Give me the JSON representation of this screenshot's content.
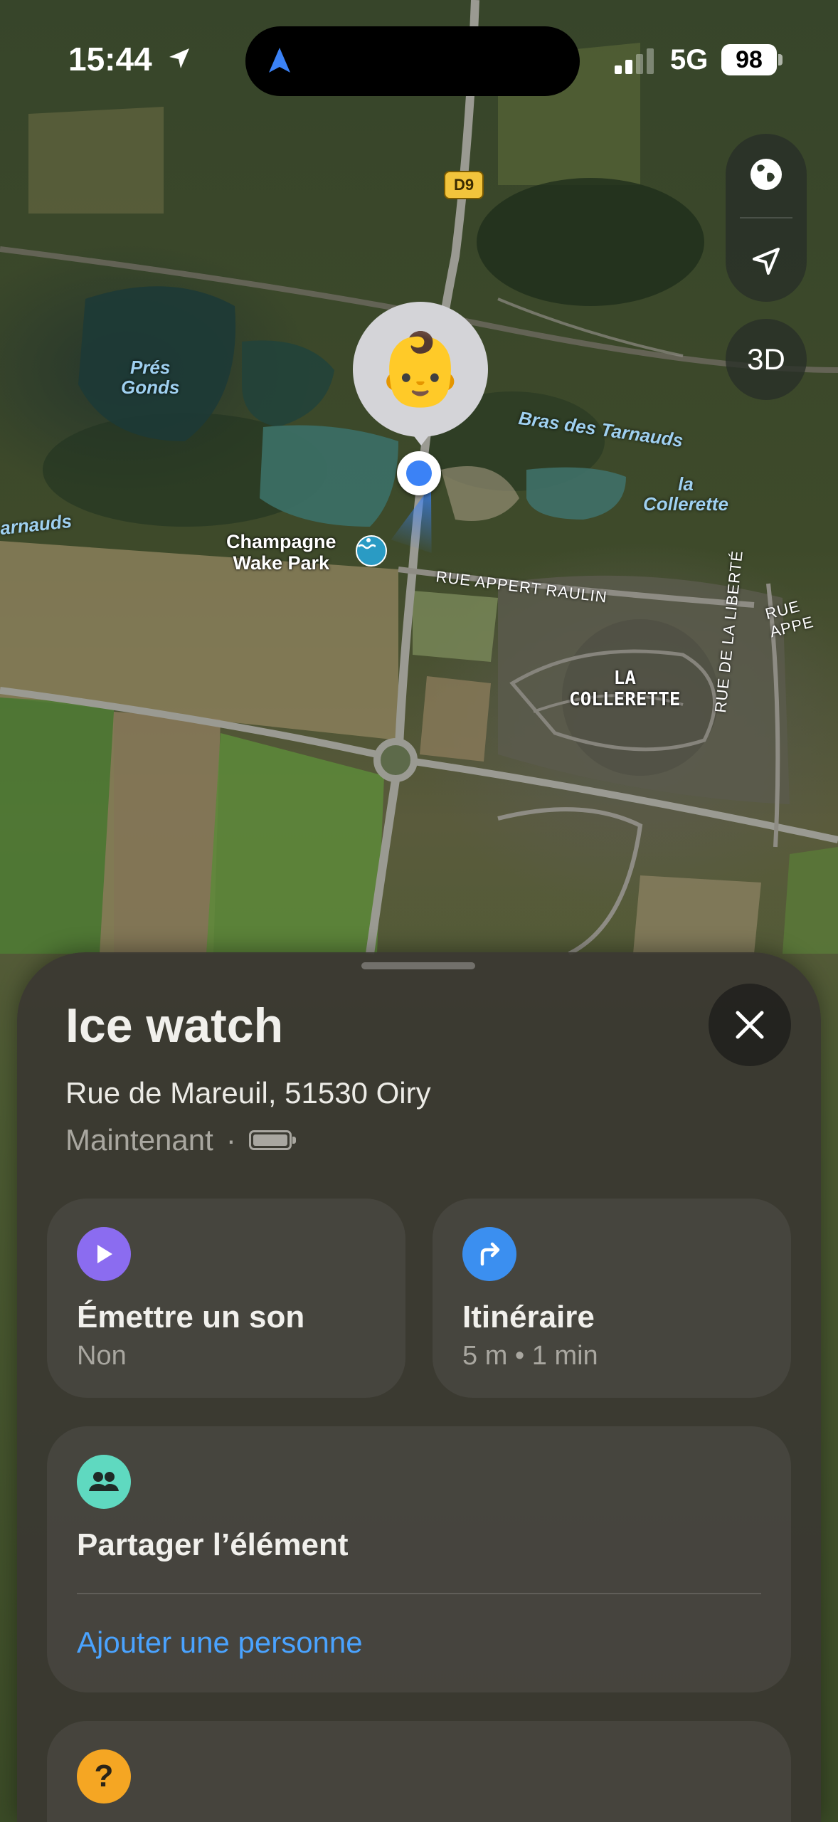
{
  "status_bar": {
    "time": "15:44",
    "network": "5G",
    "battery": "98"
  },
  "map": {
    "controls": {
      "globe_icon": "globe-icon",
      "location_icon": "location-arrow-icon",
      "three_d_label": "3D"
    },
    "road_badge": "D9",
    "labels": {
      "pres_gonds_1": "Prés",
      "pres_gonds_2": "Gonds",
      "bras": "Bras des Tarnauds",
      "collerette_water_1": "la",
      "collerette_water_2": "Collerette",
      "tarnauds_left": "arnauds",
      "wake_park_1": "Champagne",
      "wake_park_2": "Wake Park",
      "rue_appert": "RUE APPERT RAULIN",
      "rue_appe_right": "RUE APPE",
      "la_collerette_1": "LA",
      "la_collerette_2": "COLLERETTE",
      "rue_liberte": "RUE DE LA LIBERTÉ"
    },
    "pin_emoji": "👶"
  },
  "sheet": {
    "title": "Ice watch",
    "address": "Rue de Mareuil, 51530 Oiry",
    "time_label": "Maintenant",
    "separator": "·",
    "sound_card": {
      "title": "Émettre un son",
      "subtitle": "Non",
      "icon_color": "#8b6cf0"
    },
    "route_card": {
      "title": "Itinéraire",
      "subtitle": "5 m • 1 min",
      "icon_color": "#3b8ff0"
    },
    "share_card": {
      "title": "Partager l’élément",
      "link": "Ajouter une personne",
      "icon_color": "#5fd9c0"
    },
    "bottom_card": {
      "icon_label": "?",
      "icon_color": "#f5a623"
    }
  }
}
